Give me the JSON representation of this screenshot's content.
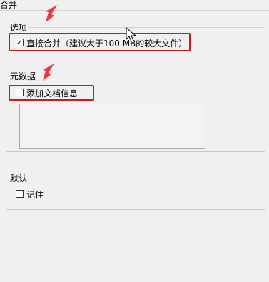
{
  "window": {
    "title": "合并"
  },
  "options": {
    "group_label": "选项",
    "direct_merge": {
      "label": "直接合并（建议大于100 MB的较大文件）",
      "checked": true,
      "check_glyph": "✓"
    }
  },
  "metadata": {
    "group_label": "元数据",
    "add_doc_info": {
      "label": "添加文档信息",
      "checked": false
    },
    "info_text": ""
  },
  "defaults": {
    "group_label": "默认",
    "remember": {
      "label": "记住",
      "checked": false
    }
  },
  "annotations": {
    "highlight_color": "#d0161f",
    "arrow_color": "#e8383d"
  },
  "icons": {
    "annotation_arrow": "red-arrow-icon",
    "pointer": "mouse-cursor-icon",
    "checkmark": "checkmark-icon"
  }
}
